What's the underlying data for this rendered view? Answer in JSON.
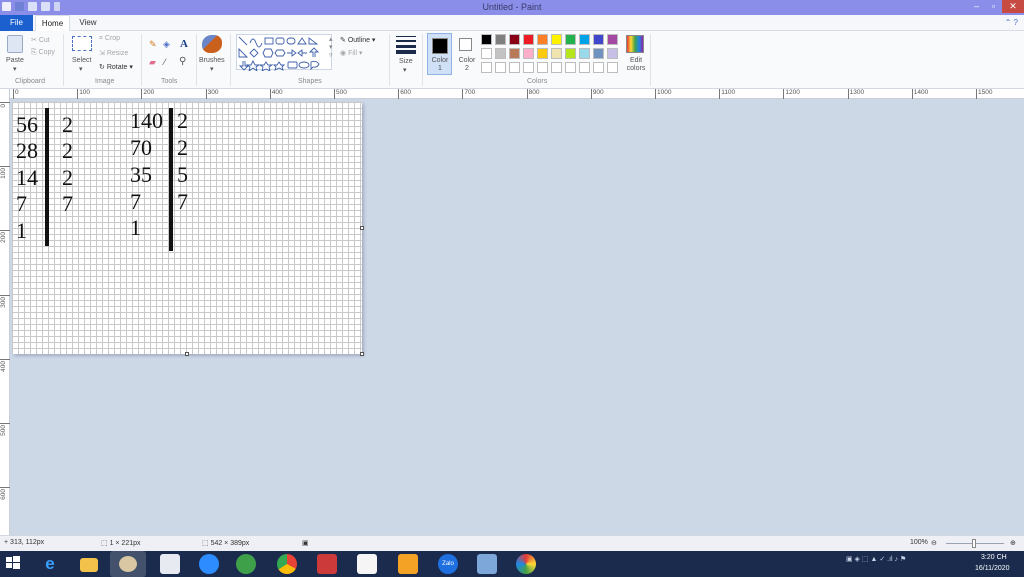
{
  "window": {
    "title": "Untitled - Paint"
  },
  "tabs": {
    "file": "File",
    "home": "Home",
    "view": "View"
  },
  "clipboard": {
    "paste": "Paste",
    "cut": "Cut",
    "copy": "Copy",
    "label": "Clipboard"
  },
  "image": {
    "select": "Select",
    "crop": "Crop",
    "resize": "Resize",
    "rotate": "Rotate ▾",
    "label": "Image"
  },
  "tools": {
    "label": "Tools",
    "text_glyph": "A"
  },
  "brushes": {
    "label": "Brushes"
  },
  "shapes": {
    "outline": "Outline ▾",
    "fill": "Fill ▾",
    "label": "Shapes"
  },
  "size": {
    "label": "Size"
  },
  "colors": {
    "color1": "Color 1",
    "color2": "Color 2",
    "edit": "Edit colors",
    "label": "Colors",
    "color1_value": "#000000",
    "color2_value": "#ffffff",
    "palette_row1": [
      "#000000",
      "#7f7f7f",
      "#880015",
      "#ed1c24",
      "#ff7f27",
      "#fff200",
      "#22b14c",
      "#00a2e8",
      "#3f48cc",
      "#a349a4"
    ],
    "palette_row2": [
      "#ffffff",
      "#c3c3c3",
      "#b97a57",
      "#ffaec9",
      "#ffc90e",
      "#efe4b0",
      "#b5e61d",
      "#99d9ea",
      "#7092be",
      "#c8bfe7"
    ],
    "palette_row3": [
      "#ffffff",
      "#ffffff",
      "#ffffff",
      "#ffffff",
      "#ffffff",
      "#ffffff",
      "#ffffff",
      "#ffffff",
      "#ffffff",
      "#ffffff"
    ]
  },
  "ruler": {
    "h_ticks": [
      "0",
      "100",
      "200",
      "300",
      "400",
      "500",
      "600",
      "700",
      "800",
      "900",
      "1000",
      "1100",
      "1200",
      "1300",
      "1400",
      "1500"
    ],
    "v_ticks": [
      "0",
      "100",
      "200",
      "300",
      "400",
      "500",
      "600"
    ]
  },
  "canvas": {
    "left_column": [
      "56",
      "28",
      "14",
      "7",
      "1"
    ],
    "left_divisors": [
      "2",
      "2",
      "2",
      "7"
    ],
    "right_column": [
      "140",
      "70",
      "35",
      "7",
      "1"
    ],
    "right_divisors": [
      "2",
      "2",
      "5",
      "7"
    ]
  },
  "status": {
    "cursor": "313, 112px",
    "selection": "1 × 221px",
    "canvas_size": "542 × 389px",
    "zoom": "100%"
  },
  "taskbar": {
    "time": "3:20 CH",
    "date": "16/11/2020",
    "zalo_label": "Zalo"
  }
}
